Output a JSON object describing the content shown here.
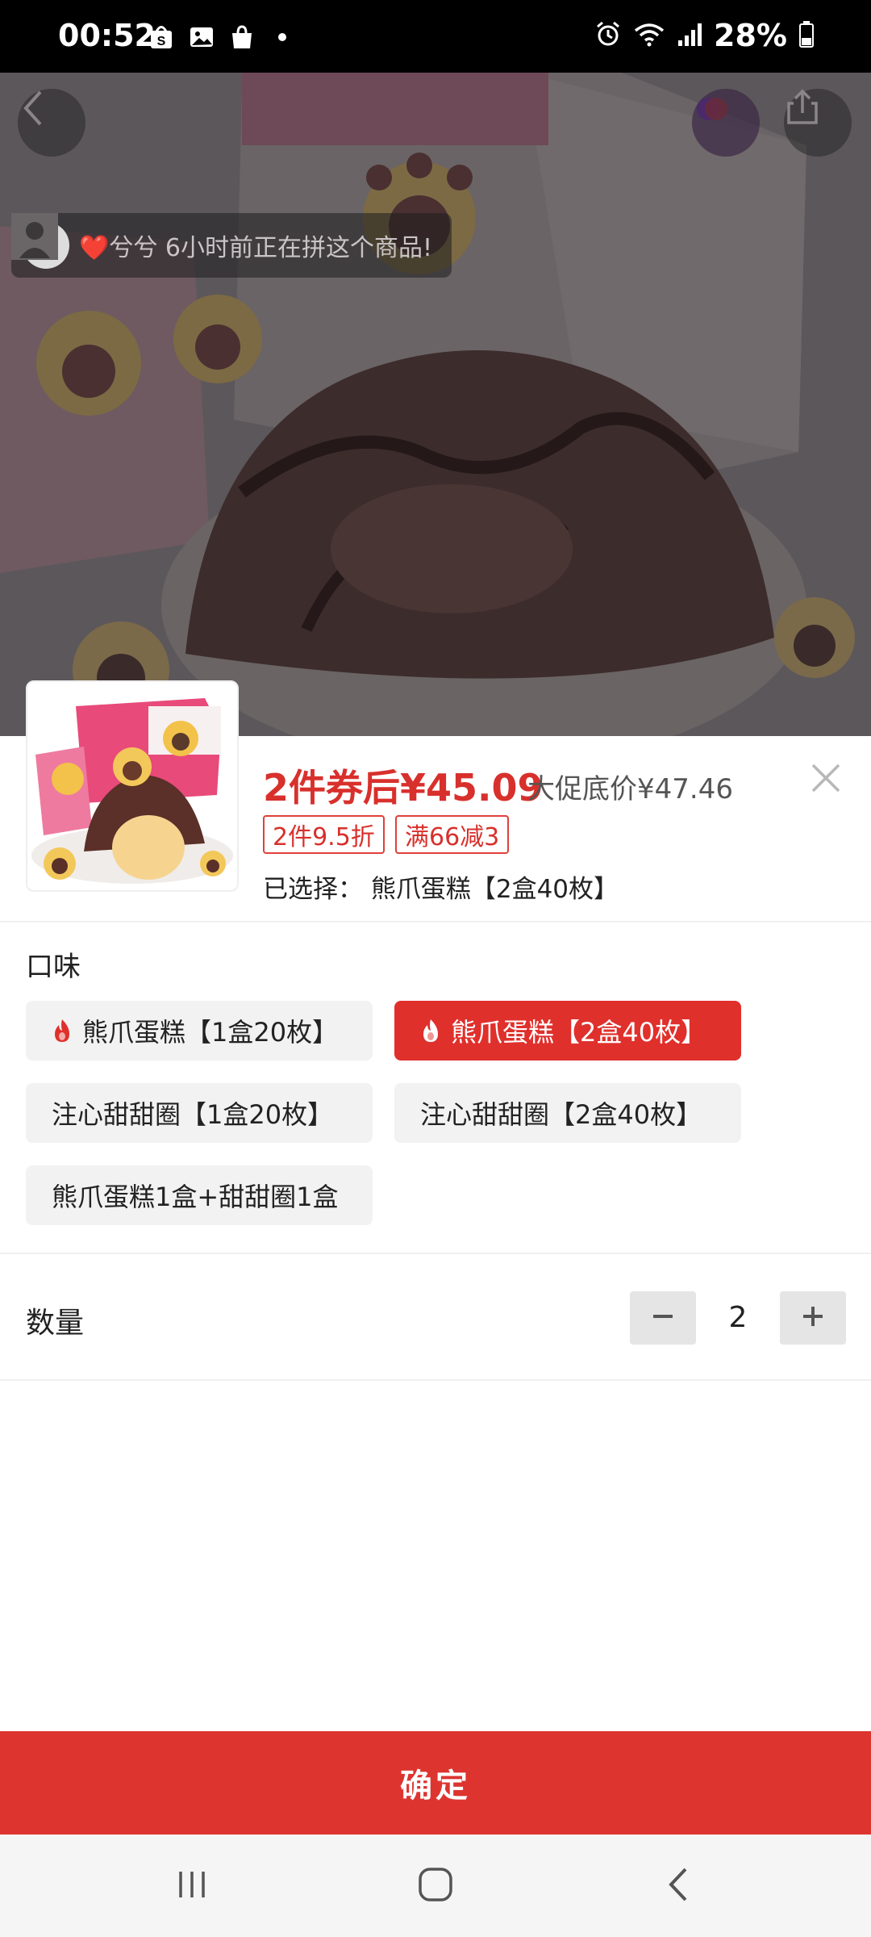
{
  "status": {
    "time": "00:52",
    "battery": "28%"
  },
  "hero": {
    "group_tip": "❤️兮兮 6小时前正在拼这个商品!"
  },
  "sheet": {
    "price_main": "2件券后¥45.09",
    "price_original": "大促底价¥47.46",
    "tags": [
      "2件9.5折",
      "满66减3"
    ],
    "selected": "已选择： 熊爪蛋糕【2盒40枚】"
  },
  "flavor": {
    "title": "口味",
    "options": [
      {
        "label": "熊爪蛋糕【1盒20枚】",
        "hot": true,
        "selected": false
      },
      {
        "label": "熊爪蛋糕【2盒40枚】",
        "hot": true,
        "selected": true
      },
      {
        "label": "注心甜甜圈【1盒20枚】",
        "hot": false,
        "selected": false
      },
      {
        "label": "注心甜甜圈【2盒40枚】",
        "hot": false,
        "selected": false
      },
      {
        "label": "熊爪蛋糕1盒+甜甜圈1盒",
        "hot": false,
        "selected": false
      }
    ]
  },
  "quantity": {
    "label": "数量",
    "value": "2",
    "minus": "−",
    "plus": "+"
  },
  "confirm_label": "确定",
  "colors": {
    "accent": "#dd3430",
    "price": "#d8302c"
  }
}
